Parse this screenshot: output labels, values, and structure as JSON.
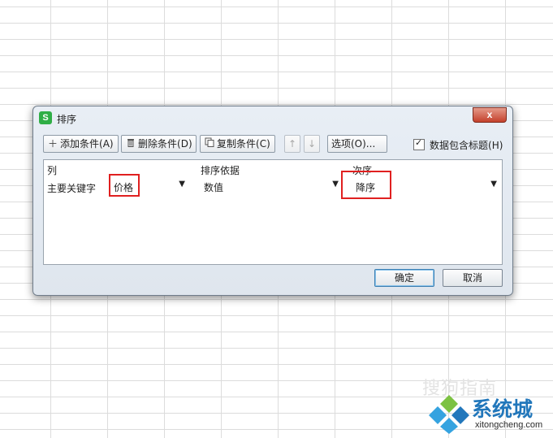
{
  "dialog": {
    "title": "排序",
    "app_icon_letter": "S",
    "close_glyph": "x"
  },
  "toolbar": {
    "add_condition": "添加条件",
    "add_condition_key": "(A)",
    "delete_condition": "删除条件",
    "delete_condition_key": "(D)",
    "copy_condition": "复制条件",
    "copy_condition_key": "(C)",
    "move_up": "↑",
    "move_down": "↓",
    "options": "选项(O)...",
    "header_checkbox_label": "数据包含标题",
    "header_checkbox_key": "(H)",
    "header_checkbox_checked": true
  },
  "grid": {
    "headers": {
      "column": "列",
      "sort_on": "排序依据",
      "order": "次序"
    },
    "row": {
      "label": "主要关键字",
      "column_value": "价格",
      "sort_on_value": "数值",
      "order_value": "降序"
    }
  },
  "buttons": {
    "ok": "确定",
    "cancel": "取消"
  },
  "watermark": {
    "faint_text": "搜狗指南",
    "brand": "系统城",
    "site": "xitongcheng.com",
    "colors": {
      "blue": "#2277bb",
      "green": "#7cc242",
      "light_blue": "#35a3e0"
    }
  }
}
